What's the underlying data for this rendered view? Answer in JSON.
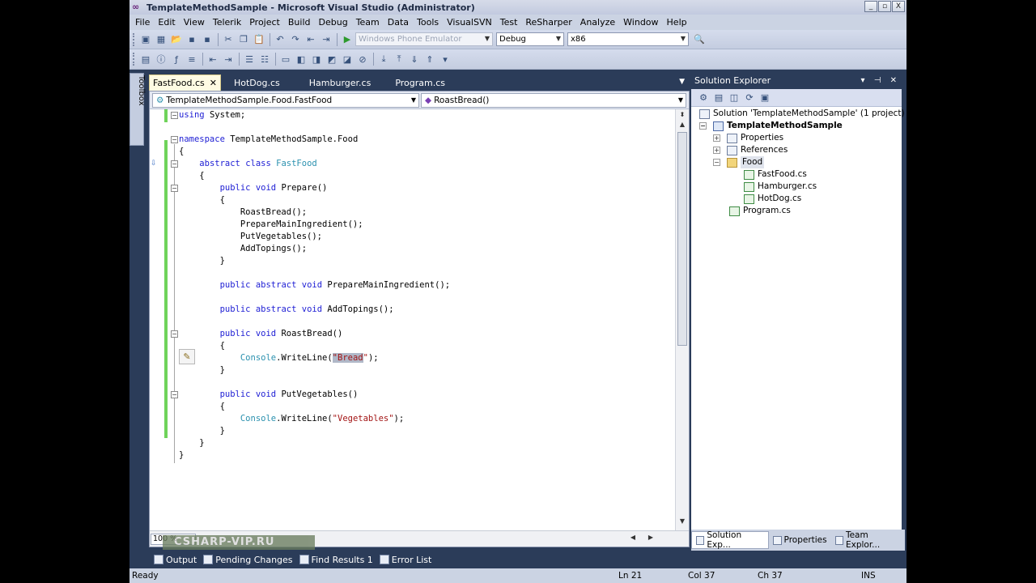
{
  "window": {
    "title": "TemplateMethodSample - Microsoft Visual Studio (Administrator)",
    "buttons": [
      "_",
      "▫",
      "X"
    ]
  },
  "menu": [
    "File",
    "Edit",
    "View",
    "Telerik",
    "Project",
    "Build",
    "Debug",
    "Team",
    "Data",
    "Tools",
    "VisualSVN",
    "Test",
    "ReSharper",
    "Analyze",
    "Window",
    "Help"
  ],
  "toolbar": {
    "target_combo": "Windows Phone Emulator",
    "config_combo": "Debug",
    "platform_combo": "x86"
  },
  "toolbox_label": "Toolbox",
  "doc_tabs": [
    {
      "label": "FastFood.cs",
      "active": true,
      "close": "✕"
    },
    {
      "label": "HotDog.cs",
      "active": false
    },
    {
      "label": "Hamburger.cs",
      "active": false
    },
    {
      "label": "Program.cs",
      "active": false
    }
  ],
  "nav": {
    "type": "TemplateMethodSample.Food.FastFood",
    "member": "RoastBread()"
  },
  "code_lines": [
    "using System;",
    "",
    "namespace TemplateMethodSample.Food",
    "{",
    "    abstract class FastFood",
    "    {",
    "        public void Prepare()",
    "        {",
    "            RoastBread();",
    "            PrepareMainIngredient();",
    "            PutVegetables();",
    "            AddTopings();",
    "        }",
    "",
    "        public abstract void PrepareMainIngredient();",
    "",
    "        public abstract void AddTopings();",
    "",
    "        public void RoastBread()",
    "        {",
    "            Console.WriteLine(\"Bread\");",
    "        }",
    "",
    "        public void PutVegetables()",
    "        {",
    "            Console.WriteLine(\"Vegetables\");",
    "        }",
    "    }",
    "}"
  ],
  "editor": {
    "zoom": "100 %"
  },
  "watermark": "CSHARP-VIP.RU",
  "bottom_tabs": [
    "Output",
    "Pending Changes",
    "Find Results 1",
    "Error List"
  ],
  "status": {
    "left": "Ready",
    "ln": "Ln 21",
    "col": "Col 37",
    "ch": "Ch 37",
    "mode": "INS"
  },
  "solution_explorer": {
    "title": "Solution Explorer",
    "controls": "▾ ⊣ ✕",
    "nodes": [
      {
        "label": "Solution 'TemplateMethodSample' (1 project)",
        "level": 0,
        "icon": "solution-icon",
        "expander": ""
      },
      {
        "label": "TemplateMethodSample",
        "level": 0,
        "icon": "project-icon",
        "expander": "−",
        "bold": true
      },
      {
        "label": "Properties",
        "level": 1,
        "icon": "properties-icon",
        "expander": "+"
      },
      {
        "label": "References",
        "level": 1,
        "icon": "references-icon",
        "expander": "+"
      },
      {
        "label": "Food",
        "level": 1,
        "icon": "folder-icon",
        "expander": "−",
        "selected": true
      },
      {
        "label": "FastFood.cs",
        "level": 2,
        "icon": "cs-file-icon",
        "expander": ""
      },
      {
        "label": "Hamburger.cs",
        "level": 2,
        "icon": "cs-file-icon",
        "expander": ""
      },
      {
        "label": "HotDog.cs",
        "level": 2,
        "icon": "cs-file-icon",
        "expander": ""
      },
      {
        "label": "Program.cs",
        "level": 1,
        "icon": "cs-file-icon",
        "expander": ""
      }
    ],
    "tabs": [
      "Solution Exp...",
      "Properties",
      "Team Explor..."
    ]
  }
}
